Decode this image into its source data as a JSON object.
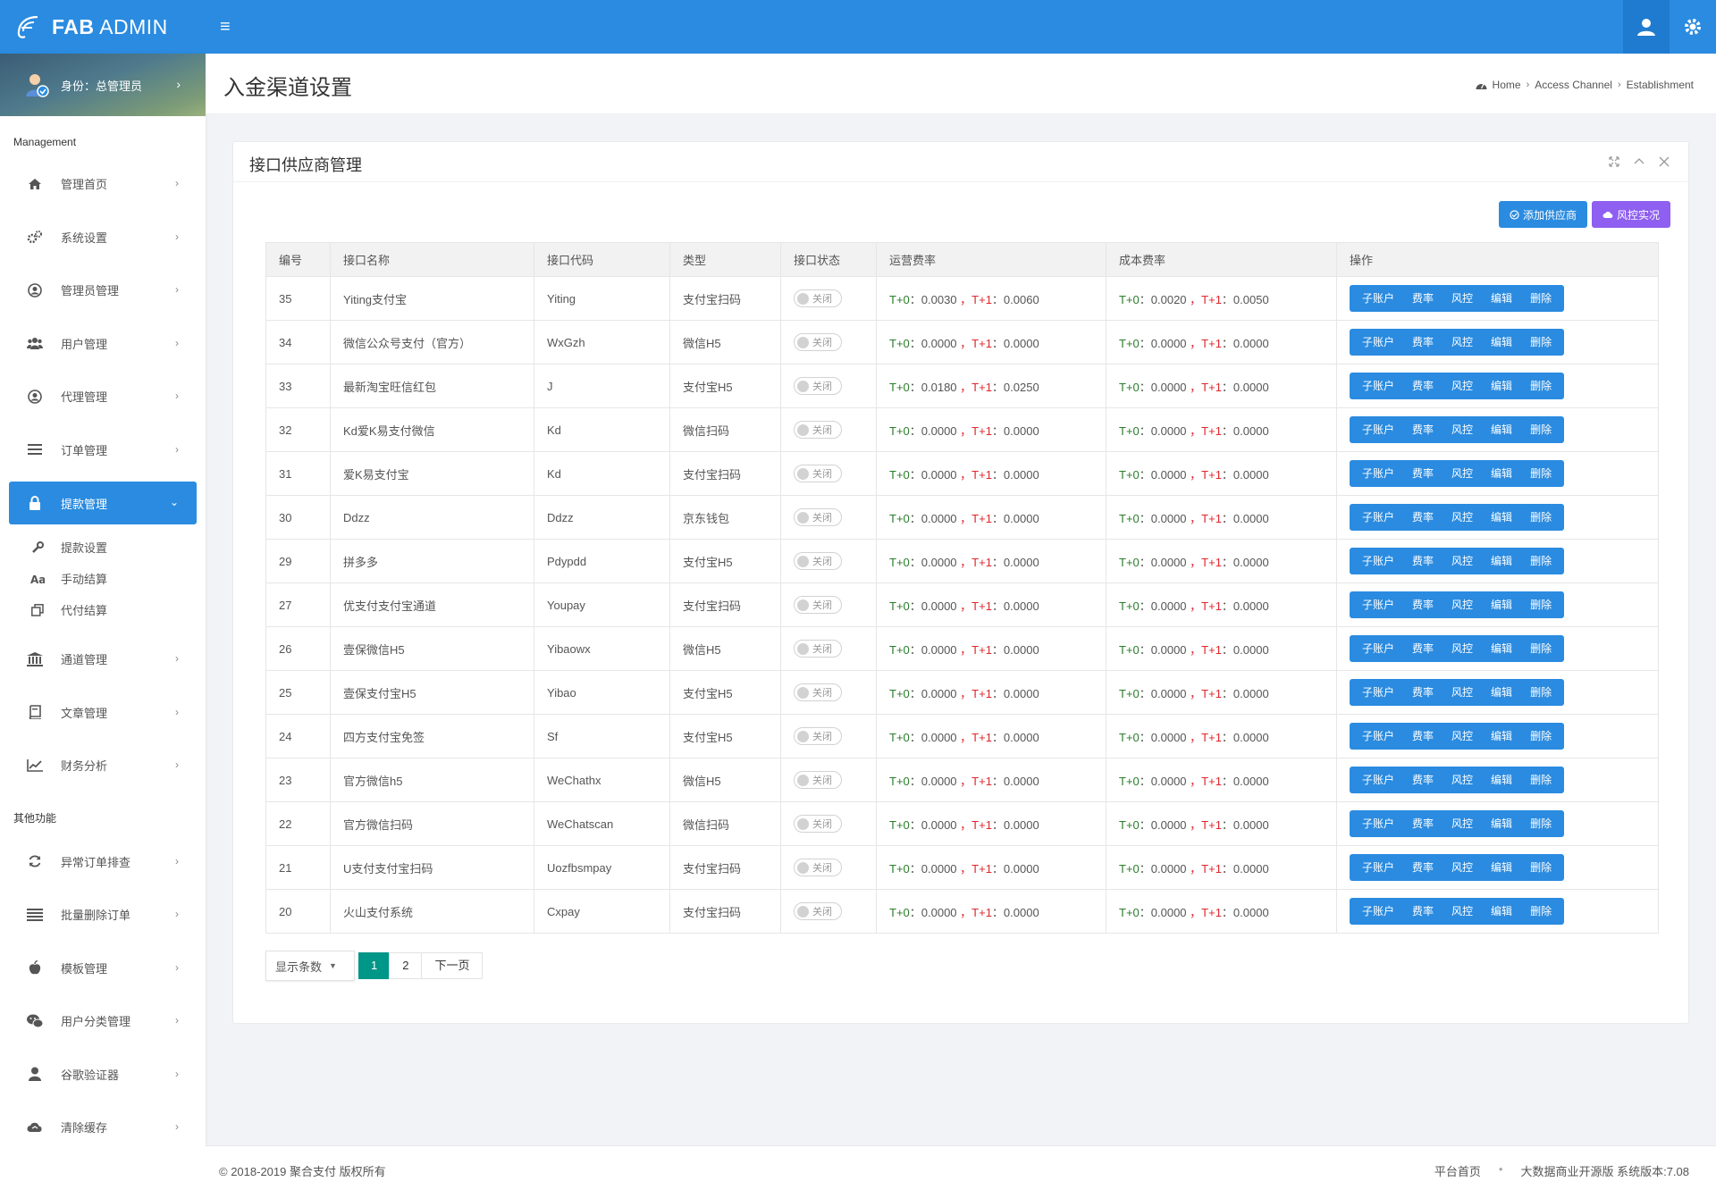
{
  "brand": {
    "bold": "FAB",
    "rest": " ADMIN"
  },
  "profile": {
    "label": "身份：总管理员"
  },
  "sidebar": {
    "section1": "Management",
    "items1": [
      {
        "label": "管理首页",
        "icon": "home-icon"
      },
      {
        "label": "系统设置",
        "icon": "gears-icon"
      },
      {
        "label": "管理员管理",
        "icon": "user-circle-icon"
      },
      {
        "label": "用户管理",
        "icon": "users-icon"
      },
      {
        "label": "代理管理",
        "icon": "user-circle-icon"
      },
      {
        "label": "订单管理",
        "icon": "list-icon"
      }
    ],
    "active": {
      "label": "提款管理",
      "icon": "lock-icon"
    },
    "subitems": [
      {
        "label": "提款设置",
        "icon": "wrench-icon"
      },
      {
        "label": "手动结算",
        "icon": "font-icon"
      },
      {
        "label": "代付结算",
        "icon": "clone-icon"
      }
    ],
    "items2": [
      {
        "label": "通道管理",
        "icon": "bank-icon"
      },
      {
        "label": "文章管理",
        "icon": "book-icon"
      },
      {
        "label": "财务分析",
        "icon": "chart-icon"
      }
    ],
    "section2": "其他功能",
    "items3": [
      {
        "label": "异常订单排查",
        "icon": "refresh-icon"
      },
      {
        "label": "批量删除订单",
        "icon": "bars-icon"
      },
      {
        "label": "模板管理",
        "icon": "apple-icon"
      },
      {
        "label": "用户分类管理",
        "icon": "wechat-icon"
      },
      {
        "label": "谷歌验证器",
        "icon": "user-icon"
      },
      {
        "label": "清除缓存",
        "icon": "cloud-icon"
      }
    ]
  },
  "page": {
    "title": "入金渠道设置"
  },
  "breadcrumb": [
    "Home",
    "Access Channel",
    "Establishment"
  ],
  "card": {
    "title": "接口供应商管理",
    "add_label": "添加供应商",
    "risk_label": "风控实况"
  },
  "table": {
    "headers": [
      "编号",
      "接口名称",
      "接口代码",
      "类型",
      "接口状态",
      "运营费率",
      "成本费率",
      "操作"
    ],
    "switch_label": "关闭",
    "rate_t0": "T+0",
    "rate_t1": "T+1",
    "rate_colon": "：",
    "rate_comma": "，",
    "ops": [
      "子账户",
      "费率",
      "风控",
      "编辑",
      "删除"
    ],
    "rows": [
      {
        "id": "35",
        "name": "Yiting支付宝",
        "code": "Yiting",
        "type": "支付宝扫码",
        "op0": "0.0030",
        "op1": "0.0060",
        "c0": "0.0020",
        "c1": "0.0050"
      },
      {
        "id": "34",
        "name": "微信公众号支付（官方）",
        "code": "WxGzh",
        "type": "微信H5",
        "op0": "0.0000",
        "op1": "0.0000",
        "c0": "0.0000",
        "c1": "0.0000"
      },
      {
        "id": "33",
        "name": "最新淘宝旺信红包",
        "code": "J",
        "type": "支付宝H5",
        "op0": "0.0180",
        "op1": "0.0250",
        "c0": "0.0000",
        "c1": "0.0000"
      },
      {
        "id": "32",
        "name": "Kd爱K易支付微信",
        "code": "Kd",
        "type": "微信扫码",
        "op0": "0.0000",
        "op1": "0.0000",
        "c0": "0.0000",
        "c1": "0.0000"
      },
      {
        "id": "31",
        "name": "爱K易支付宝",
        "code": "Kd",
        "type": "支付宝扫码",
        "op0": "0.0000",
        "op1": "0.0000",
        "c0": "0.0000",
        "c1": "0.0000"
      },
      {
        "id": "30",
        "name": "Ddzz",
        "code": "Ddzz",
        "type": "京东钱包",
        "op0": "0.0000",
        "op1": "0.0000",
        "c0": "0.0000",
        "c1": "0.0000"
      },
      {
        "id": "29",
        "name": "拼多多",
        "code": "Pdypdd",
        "type": "支付宝H5",
        "op0": "0.0000",
        "op1": "0.0000",
        "c0": "0.0000",
        "c1": "0.0000"
      },
      {
        "id": "27",
        "name": "优支付支付宝通道",
        "code": "Youpay",
        "type": "支付宝扫码",
        "op0": "0.0000",
        "op1": "0.0000",
        "c0": "0.0000",
        "c1": "0.0000"
      },
      {
        "id": "26",
        "name": "壹保微信H5",
        "code": "Yibaowx",
        "type": "微信H5",
        "op0": "0.0000",
        "op1": "0.0000",
        "c0": "0.0000",
        "c1": "0.0000"
      },
      {
        "id": "25",
        "name": "壹保支付宝H5",
        "code": "Yibao",
        "type": "支付宝H5",
        "op0": "0.0000",
        "op1": "0.0000",
        "c0": "0.0000",
        "c1": "0.0000"
      },
      {
        "id": "24",
        "name": "四方支付宝免签",
        "code": "Sf",
        "type": "支付宝H5",
        "op0": "0.0000",
        "op1": "0.0000",
        "c0": "0.0000",
        "c1": "0.0000"
      },
      {
        "id": "23",
        "name": "官方微信h5",
        "code": "WeChathx",
        "type": "微信H5",
        "op0": "0.0000",
        "op1": "0.0000",
        "c0": "0.0000",
        "c1": "0.0000"
      },
      {
        "id": "22",
        "name": "官方微信扫码",
        "code": "WeChatscan",
        "type": "微信扫码",
        "op0": "0.0000",
        "op1": "0.0000",
        "c0": "0.0000",
        "c1": "0.0000"
      },
      {
        "id": "21",
        "name": "U支付支付宝扫码",
        "code": "Uozfbsmpay",
        "type": "支付宝扫码",
        "op0": "0.0000",
        "op1": "0.0000",
        "c0": "0.0000",
        "c1": "0.0000"
      },
      {
        "id": "20",
        "name": "火山支付系统",
        "code": "Cxpay",
        "type": "支付宝扫码",
        "op0": "0.0000",
        "op1": "0.0000",
        "c0": "0.0000",
        "c1": "0.0000"
      }
    ]
  },
  "pager": {
    "limit_label": "显示条数",
    "pages": [
      "1",
      "2"
    ],
    "current": "1",
    "next_label": "下一页"
  },
  "footer": {
    "copyright": "© 2018-2019 聚合支付 版权所有",
    "link1": "平台首页",
    "dot": "•",
    "link2": "大数据商业开源版 系统版本:7.08"
  },
  "colors": {
    "primary": "#2a8be0",
    "purple": "#8e5ff0",
    "teal": "#009688",
    "t0": "#2a7d2a",
    "t1": "#e0262b"
  }
}
